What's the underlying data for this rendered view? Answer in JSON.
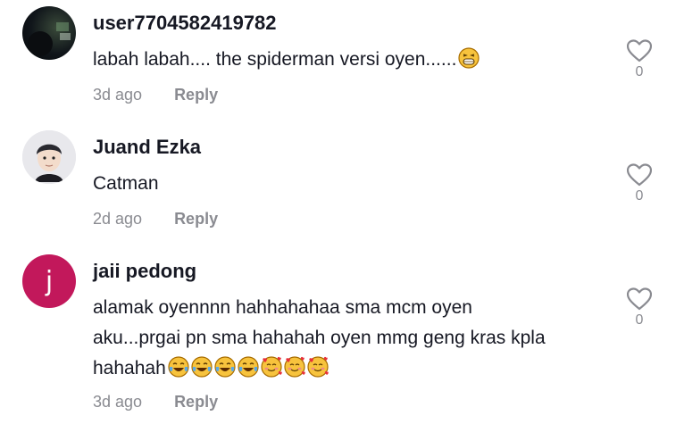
{
  "comments": [
    {
      "username": "user7704582419782",
      "text": "labah labah.... the spiderman versi oyen......",
      "emojis": [
        "grinning-squint"
      ],
      "time": "3d ago",
      "reply_label": "Reply",
      "likes": "0",
      "avatar": "dark-photo"
    },
    {
      "username": "Juand Ezka",
      "text": "Catman",
      "emojis": [],
      "time": "2d ago",
      "reply_label": "Reply",
      "likes": "0",
      "avatar": "cartoon-face"
    },
    {
      "username": "jaii pedong",
      "text_lines": [
        "alamak oyennnn hahhahahaa sma mcm oyen",
        "aku...prgai pn sma hahahah oyen mmg geng kras kpla",
        "hahahah"
      ],
      "emojis": [
        "tears-of-joy",
        "tears-of-joy",
        "tears-of-joy",
        "tears-of-joy",
        "smiling-hearts",
        "smiling-hearts",
        "smiling-hearts"
      ],
      "time": "3d ago",
      "reply_label": "Reply",
      "likes": "0",
      "avatar_letter": "j",
      "avatar_color": "#c2185b"
    }
  ]
}
